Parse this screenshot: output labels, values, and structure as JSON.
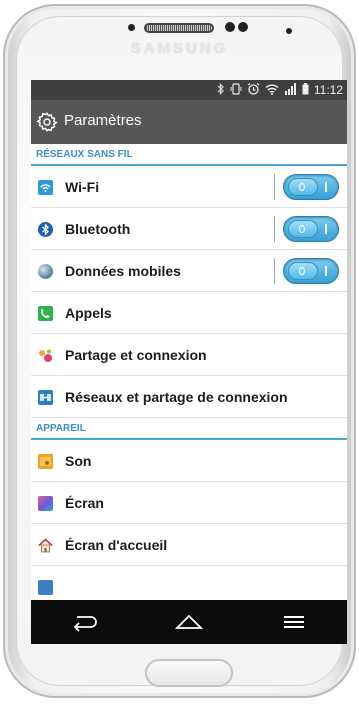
{
  "device": {
    "brand": "SAMSUNG"
  },
  "status_bar": {
    "time": "11:12",
    "icons": [
      "bluetooth-icon",
      "vibrate-icon",
      "alarm-icon",
      "wifi-icon",
      "signal-icon",
      "battery-icon"
    ]
  },
  "action_bar": {
    "title": "Paramètres",
    "icon": "settings-gear-icon"
  },
  "sections": {
    "wireless": {
      "header": "RÉSEAUX SANS FIL"
    },
    "device": {
      "header": "APPAREIL"
    }
  },
  "items": {
    "wifi": {
      "label": "Wi-Fi",
      "icon": "wifi-icon",
      "toggle_on": true
    },
    "bluetooth": {
      "label": "Bluetooth",
      "icon": "bluetooth-icon",
      "toggle_on": true
    },
    "mobile_data": {
      "label": "Données mobiles",
      "icon": "mobile-data-icon",
      "toggle_on": true
    },
    "calls": {
      "label": "Appels",
      "icon": "phone-icon"
    },
    "share_connect": {
      "label": "Partage et connexion",
      "icon": "share-icon"
    },
    "tethering": {
      "label": "Réseaux et partage de connexion",
      "icon": "tethering-icon"
    },
    "sound": {
      "label": "Son",
      "icon": "sound-icon"
    },
    "display": {
      "label": "Écran",
      "icon": "display-icon"
    },
    "home_screen": {
      "label": "Écran d'accueil",
      "icon": "home-icon"
    }
  },
  "nav_bar": {
    "buttons": [
      "back-icon",
      "home-icon",
      "menu-icon"
    ]
  },
  "colors": {
    "accent": "#4ea5d8",
    "toggle_on": "#4fb3e3",
    "action_bar": "#555658",
    "status_bar": "#3f3f3f"
  }
}
